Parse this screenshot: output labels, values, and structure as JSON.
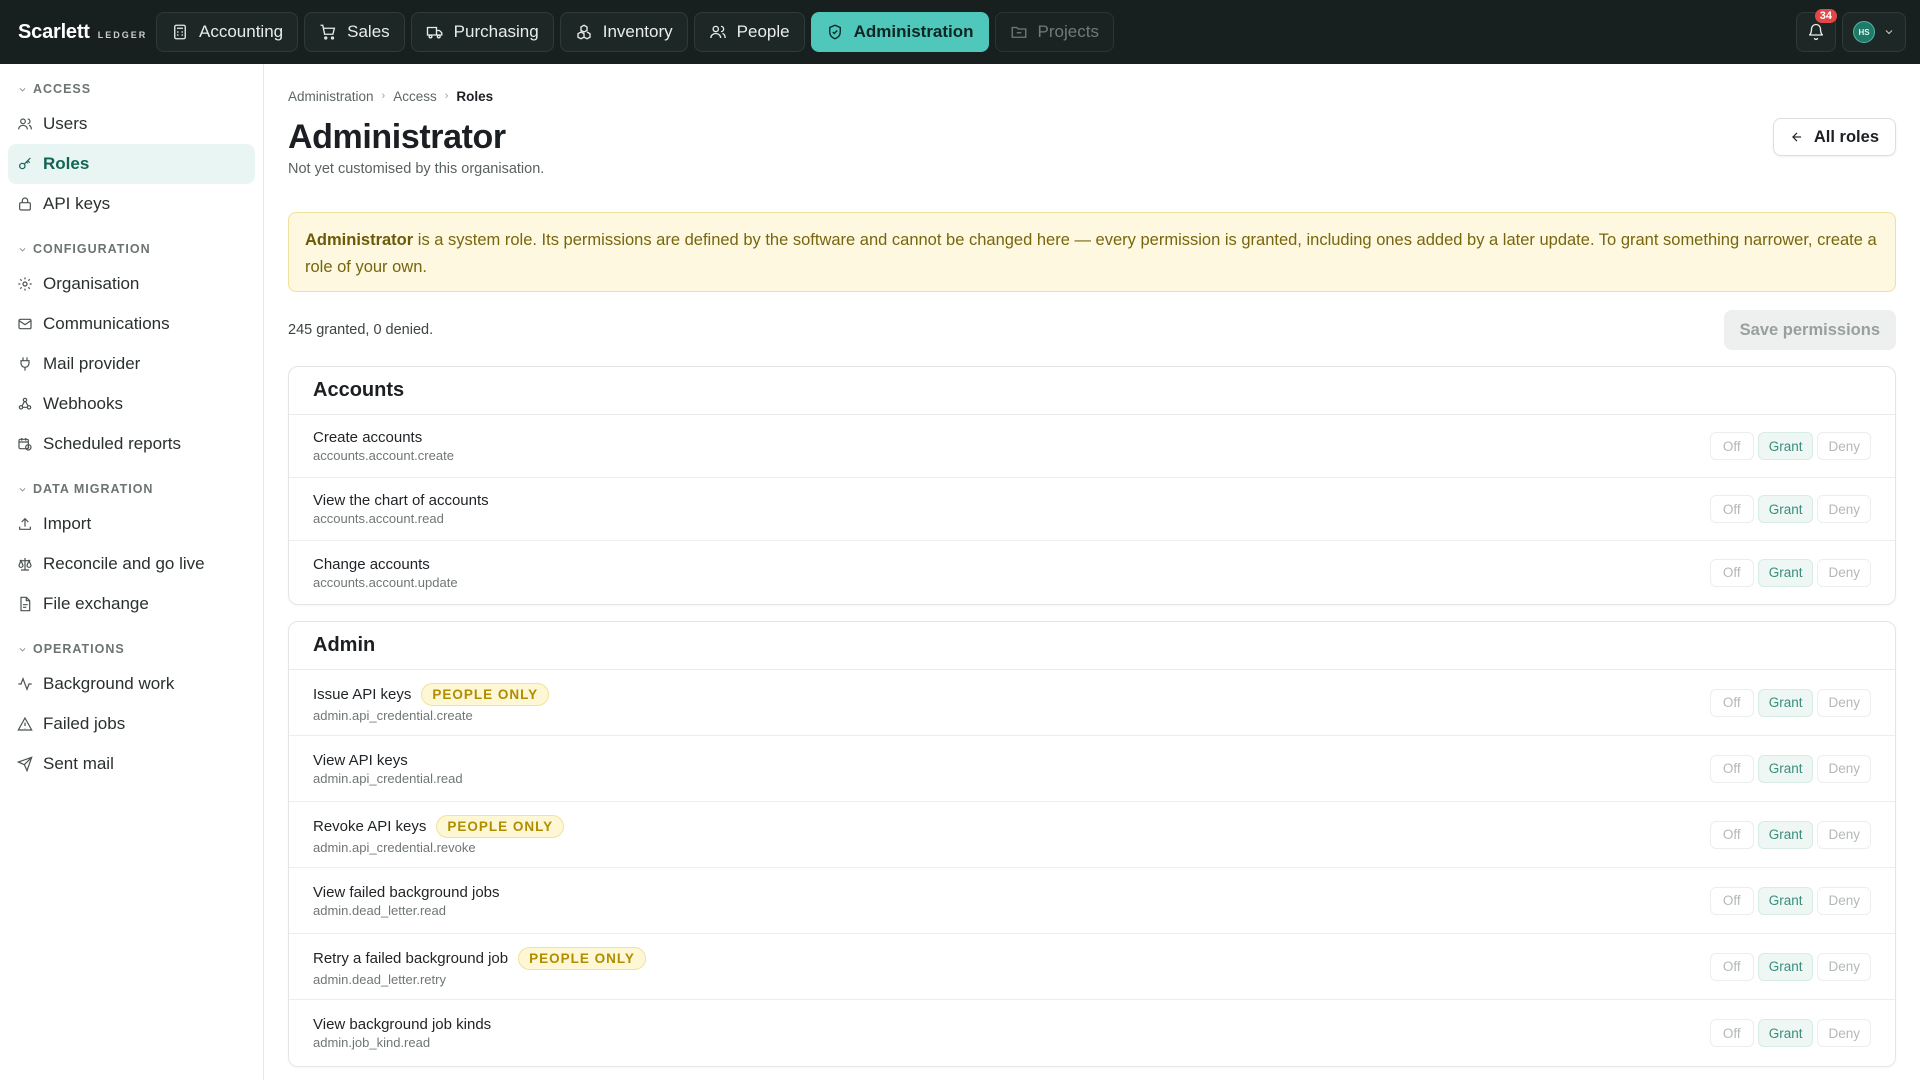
{
  "brand": {
    "name": "Scarlett",
    "sub": "LEDGER"
  },
  "nav": [
    {
      "label": "Accounting",
      "icon": "calculator-icon",
      "state": "normal"
    },
    {
      "label": "Sales",
      "icon": "cart-icon",
      "state": "normal"
    },
    {
      "label": "Purchasing",
      "icon": "truck-icon",
      "state": "normal"
    },
    {
      "label": "Inventory",
      "icon": "boxes-icon",
      "state": "normal"
    },
    {
      "label": "People",
      "icon": "users-icon",
      "state": "normal"
    },
    {
      "label": "Administration",
      "icon": "shield-icon",
      "state": "active"
    },
    {
      "label": "Projects",
      "icon": "folder-icon",
      "state": "disabled"
    }
  ],
  "notifications": {
    "count": "34"
  },
  "user": {
    "initials": "HS"
  },
  "sidebar": {
    "groups": [
      {
        "heading": "ACCESS",
        "items": [
          {
            "label": "Users",
            "icon": "users-icon"
          },
          {
            "label": "Roles",
            "icon": "key-icon",
            "active": true
          },
          {
            "label": "API keys",
            "icon": "lock-icon"
          }
        ]
      },
      {
        "heading": "CONFIGURATION",
        "items": [
          {
            "label": "Organisation",
            "icon": "gear-icon"
          },
          {
            "label": "Communications",
            "icon": "mail-icon"
          },
          {
            "label": "Mail provider",
            "icon": "plug-icon"
          },
          {
            "label": "Webhooks",
            "icon": "webhook-icon"
          },
          {
            "label": "Scheduled reports",
            "icon": "calendar-clock-icon"
          }
        ]
      },
      {
        "heading": "DATA MIGRATION",
        "items": [
          {
            "label": "Import",
            "icon": "upload-icon"
          },
          {
            "label": "Reconcile and go live",
            "icon": "scale-icon"
          },
          {
            "label": "File exchange",
            "icon": "file-icon"
          }
        ]
      },
      {
        "heading": "OPERATIONS",
        "items": [
          {
            "label": "Background work",
            "icon": "activity-icon"
          },
          {
            "label": "Failed jobs",
            "icon": "warning-icon"
          },
          {
            "label": "Sent mail",
            "icon": "send-icon"
          }
        ]
      }
    ]
  },
  "breadcrumb": [
    "Administration",
    "Access",
    "Roles"
  ],
  "page": {
    "title": "Administrator",
    "subtitle": "Not yet customised by this organisation.",
    "all_roles_label": "All roles"
  },
  "notice": {
    "role": "Administrator",
    "text": " is a system role. Its permissions are defined by the software and cannot be changed here — every permission is granted, including ones added by a later update. To grant something narrower, create a role of your own."
  },
  "summary": "245 granted, 0 denied.",
  "save_label": "Save permissions",
  "segment_labels": {
    "off": "Off",
    "grant": "Grant",
    "deny": "Deny"
  },
  "sections": [
    {
      "name": "Accounts",
      "class": "accounts",
      "rows": [
        {
          "title": "Create accounts",
          "key": "accounts.account.create",
          "value": "Grant"
        },
        {
          "title": "View the chart of accounts",
          "key": "accounts.account.read",
          "value": "Grant"
        },
        {
          "title": "Change accounts",
          "key": "accounts.account.update",
          "value": "Grant"
        }
      ]
    },
    {
      "name": "Admin",
      "class": "admin",
      "rows": [
        {
          "title": "Issue API keys",
          "key": "admin.api_credential.create",
          "badge": "PEOPLE ONLY",
          "value": "Grant"
        },
        {
          "title": "View API keys",
          "key": "admin.api_credential.read",
          "value": "Grant"
        },
        {
          "title": "Revoke API keys",
          "key": "admin.api_credential.revoke",
          "badge": "PEOPLE ONLY",
          "value": "Grant"
        },
        {
          "title": "View failed background jobs",
          "key": "admin.dead_letter.read",
          "value": "Grant"
        },
        {
          "title": "Retry a failed background job",
          "key": "admin.dead_letter.retry",
          "badge": "PEOPLE ONLY",
          "value": "Grant"
        },
        {
          "title": "View background job kinds",
          "key": "admin.job_kind.read",
          "value": "Grant"
        }
      ]
    }
  ]
}
